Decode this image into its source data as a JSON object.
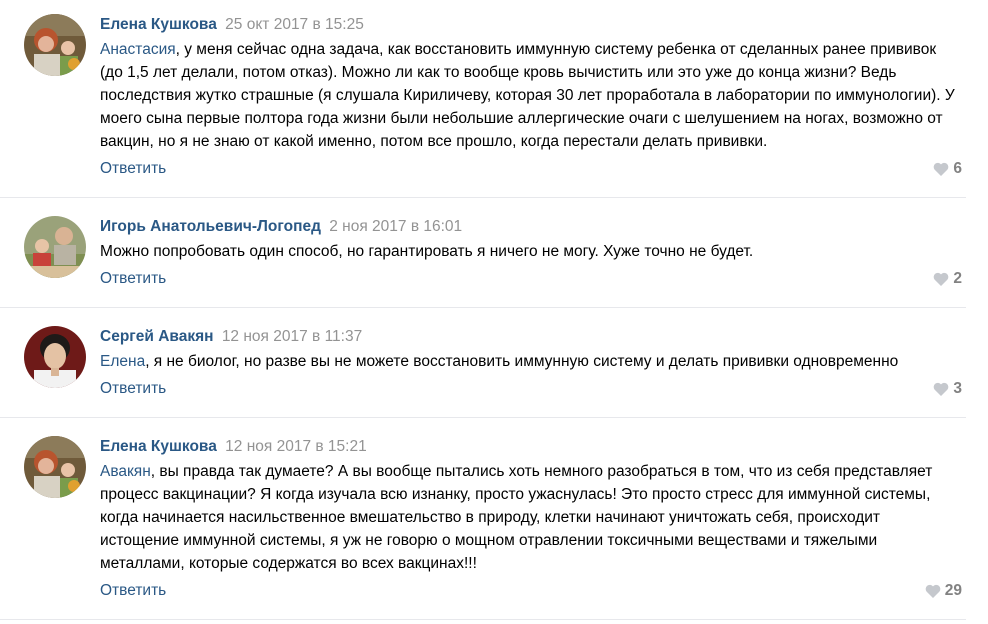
{
  "reply_label": "Ответить",
  "comments": [
    {
      "author": "Елена Кушкова",
      "date": "25 окт 2017 в 15:25",
      "mention": "Анастасия",
      "text": ", у меня сейчас одна задача, как восстановить иммунную систему ребенка от сделанных ранее прививок (до 1,5 лет делали, потом отказ). Можно ли как то вообще кровь вычистить или это уже до конца жизни? Ведь последствия жутко страшные (я слушала Кириличеву, которая 30 лет проработала в лаборатории по иммунологии). У моего сына первые полтора года жизни были небольшие аллергические очаги с шелушением на ногах, возможно от вакцин, но я не знаю от какой именно, потом все прошло, когда перестали делать прививки.",
      "likes": "6",
      "avatar": "woman-with-child-photo"
    },
    {
      "author": "Игорь Анатольевич-Логопед",
      "date": "2 ноя 2017 в 16:01",
      "mention": "",
      "text": "Можно попробовать один способ, но гарантировать я ничего не могу. Хуже точно не будет.",
      "likes": "2",
      "avatar": "man-with-child-photo"
    },
    {
      "author": "Сергей Авакян",
      "date": "12 ноя 2017 в 11:37",
      "mention": "Елена",
      "text": ", я не биолог, но разве вы не можете восстановить иммунную систему и делать прививки одновременно",
      "likes": "3",
      "avatar": "man-portrait-photo"
    },
    {
      "author": "Елена Кушкова",
      "date": "12 ноя 2017 в 15:21",
      "mention": "Авакян",
      "text": ", вы правда так думаете? А вы вообще пытались хоть немного разобраться в том, что из себя представляет процесс вакцинации? Я когда изучала всю изнанку, просто ужаснулась! Это просто стресс для иммунной системы, когда начинается насильственное вмешательство в природу, клетки начинают уничтожать себя, происходит истощение иммунной системы, я уж не говорю о мощном отравлении токсичными веществами и тяжелыми металлами, которые содержатся во всех вакцинах!!!",
      "likes": "29",
      "avatar": "woman-with-child-photo"
    }
  ],
  "colors": {
    "link": "#2a5885",
    "date": "#939393",
    "likes": "#828282",
    "heart": "#c5c8cd",
    "divider": "#e7e8ec"
  }
}
